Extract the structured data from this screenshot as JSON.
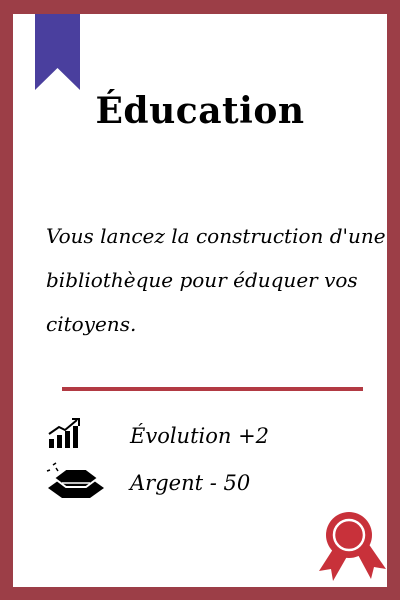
{
  "card": {
    "title": "Éducation",
    "description": "Vous lancez  la construction d'une bibliothèque pour éduquer vos citoyens.",
    "effects": [
      {
        "icon": "growth-chart-icon",
        "text": "Évolution  +2"
      },
      {
        "icon": "gold-bars-icon",
        "text": "Argent  - 50"
      }
    ]
  },
  "colors": {
    "frame": "#9c3e47",
    "bookmark": "#4a3f9e",
    "divider": "#b23a43",
    "seal": "#c8313a"
  }
}
